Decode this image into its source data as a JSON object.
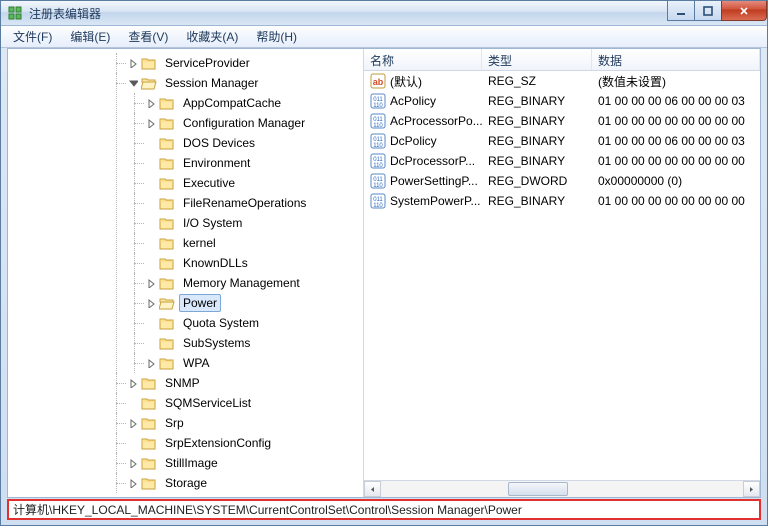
{
  "window": {
    "title": "注册表编辑器"
  },
  "menu": {
    "file": "文件(F)",
    "edit": "编辑(E)",
    "view": "查看(V)",
    "favorites": "收藏夹(A)",
    "help": "帮助(H)"
  },
  "tree": {
    "ServiceProvider": "ServiceProvider",
    "SessionManager": "Session Manager",
    "children": {
      "AppCompatCache": "AppCompatCache",
      "ConfigurationManager": "Configuration Manager",
      "DOSDevices": "DOS Devices",
      "Environment": "Environment",
      "Executive": "Executive",
      "FileRenameOperations": "FileRenameOperations",
      "IOSystem": "I/O System",
      "kernel": "kernel",
      "KnownDLLs": "KnownDLLs",
      "MemoryManagement": "Memory Management",
      "Power": "Power",
      "QuotaSystem": "Quota System",
      "SubSystems": "SubSystems",
      "WPA": "WPA"
    },
    "SNMP": "SNMP",
    "SQMServiceList": "SQMServiceList",
    "Srp": "Srp",
    "SrpExtensionConfig": "SrpExtensionConfig",
    "StillImage": "StillImage",
    "Storage": "Storage"
  },
  "columns": {
    "name": "名称",
    "type": "类型",
    "data": "数据"
  },
  "values": [
    {
      "icon": "string",
      "name": "(默认)",
      "type": "REG_SZ",
      "data": "(数值未设置)"
    },
    {
      "icon": "binary",
      "name": "AcPolicy",
      "type": "REG_BINARY",
      "data": "01 00 00 00 06 00 00 00 03"
    },
    {
      "icon": "binary",
      "name": "AcProcessorPo...",
      "type": "REG_BINARY",
      "data": "01 00 00 00 00 00 00 00 00"
    },
    {
      "icon": "binary",
      "name": "DcPolicy",
      "type": "REG_BINARY",
      "data": "01 00 00 00 06 00 00 00 03"
    },
    {
      "icon": "binary",
      "name": "DcProcessorP...",
      "type": "REG_BINARY",
      "data": "01 00 00 00 00 00 00 00 00"
    },
    {
      "icon": "binary",
      "name": "PowerSettingP...",
      "type": "REG_DWORD",
      "data": "0x00000000 (0)"
    },
    {
      "icon": "binary",
      "name": "SystemPowerP...",
      "type": "REG_BINARY",
      "data": "01 00 00 00 00 00 00 00 00"
    }
  ],
  "statusbar": "计算机\\HKEY_LOCAL_MACHINE\\SYSTEM\\CurrentControlSet\\Control\\Session Manager\\Power"
}
